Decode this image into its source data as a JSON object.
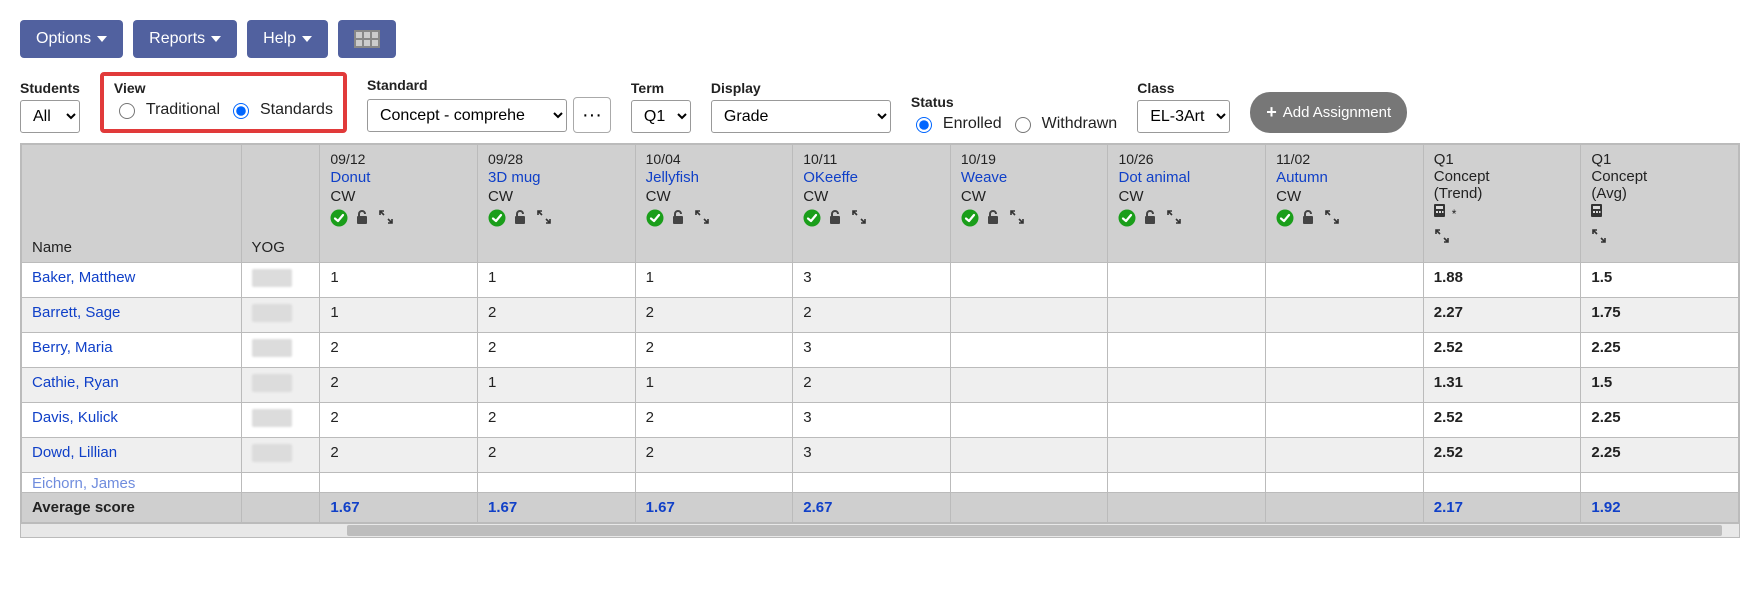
{
  "toolbar": {
    "options": "Options",
    "reports": "Reports",
    "help": "Help"
  },
  "filters": {
    "students_label": "Students",
    "students_value": "All",
    "view_label": "View",
    "view_traditional": "Traditional",
    "view_standards": "Standards",
    "standard_label": "Standard",
    "standard_value": "Concept - comprehe",
    "term_label": "Term",
    "term_value": "Q1",
    "display_label": "Display",
    "display_value": "Grade",
    "status_label": "Status",
    "status_enrolled": "Enrolled",
    "status_withdrawn": "Withdrawn",
    "class_label": "Class",
    "class_value": "EL-3Art",
    "add_assignment": "Add Assignment"
  },
  "headers": {
    "name": "Name",
    "yog": "YOG",
    "average_score": "Average score"
  },
  "assignments": [
    {
      "date": "09/12",
      "name": "Donut",
      "cat": "CW"
    },
    {
      "date": "09/28",
      "name": "3D mug",
      "cat": "CW"
    },
    {
      "date": "10/04",
      "name": "Jellyfish",
      "cat": "CW"
    },
    {
      "date": "10/11",
      "name": "OKeeffe",
      "cat": "CW"
    },
    {
      "date": "10/19",
      "name": "Weave",
      "cat": "CW"
    },
    {
      "date": "10/26",
      "name": "Dot animal",
      "cat": "CW"
    },
    {
      "date": "11/02",
      "name": "Autumn",
      "cat": "CW"
    }
  ],
  "summary_cols": [
    {
      "line1": "Q1",
      "line2": "Concept",
      "line3": "(Trend)",
      "calc": "*"
    },
    {
      "line1": "Q1",
      "line2": "Concept",
      "line3": "(Avg)",
      "calc": ""
    }
  ],
  "rows": [
    {
      "student": "Baker, Matthew",
      "scores": [
        "1",
        "1",
        "1",
        "3",
        "",
        "",
        ""
      ],
      "summary": [
        "1.88",
        "1.5"
      ]
    },
    {
      "student": "Barrett, Sage",
      "scores": [
        "1",
        "2",
        "2",
        "2",
        "",
        "",
        ""
      ],
      "summary": [
        "2.27",
        "1.75"
      ]
    },
    {
      "student": "Berry, Maria",
      "scores": [
        "2",
        "2",
        "2",
        "3",
        "",
        "",
        ""
      ],
      "summary": [
        "2.52",
        "2.25"
      ]
    },
    {
      "student": "Cathie, Ryan",
      "scores": [
        "2",
        "1",
        "1",
        "2",
        "",
        "",
        ""
      ],
      "summary": [
        "1.31",
        "1.5"
      ]
    },
    {
      "student": "Davis, Kulick",
      "scores": [
        "2",
        "2",
        "2",
        "3",
        "",
        "",
        ""
      ],
      "summary": [
        "2.52",
        "2.25"
      ]
    },
    {
      "student": "Dowd, Lillian",
      "scores": [
        "2",
        "2",
        "2",
        "3",
        "",
        "",
        ""
      ],
      "summary": [
        "2.52",
        "2.25"
      ]
    }
  ],
  "partial_row": {
    "student": "Eichorn, James"
  },
  "averages": {
    "scores": [
      "1.67",
      "1.67",
      "1.67",
      "2.67",
      "",
      "",
      ""
    ],
    "summary": [
      "2.17",
      "1.92"
    ]
  }
}
